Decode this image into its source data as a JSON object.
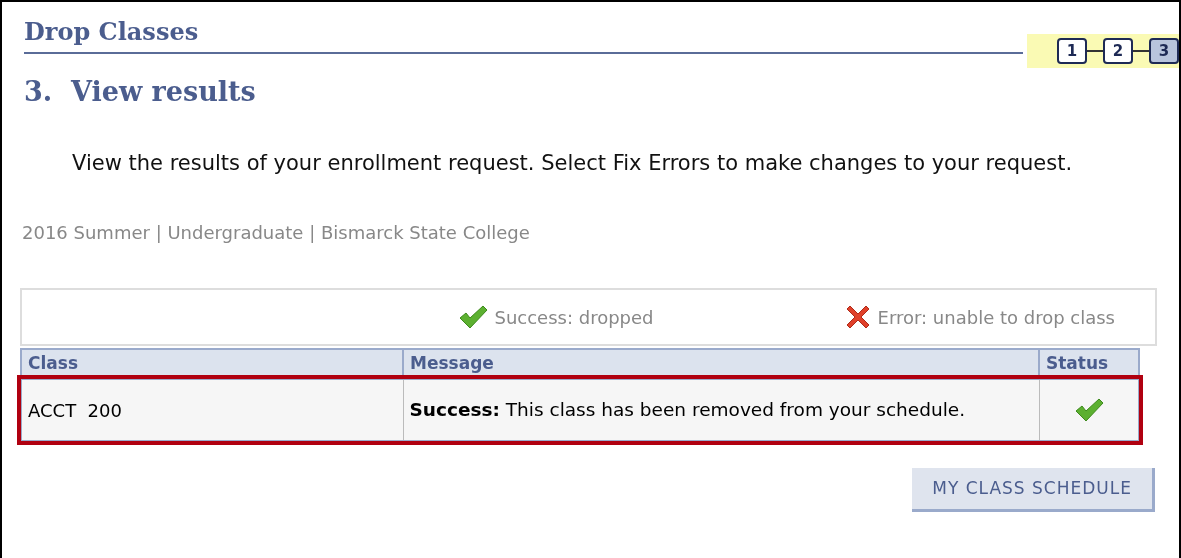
{
  "page_title": "Drop Classes",
  "steps": [
    {
      "label": "1",
      "selected": false
    },
    {
      "label": "2",
      "selected": false
    },
    {
      "label": "3",
      "selected": true
    }
  ],
  "step_heading": "3.  View results",
  "instructions": "View the results of your enrollment request.  Select Fix Errors to make changes to your request.",
  "term_info": "2016 Summer | Undergraduate | Bismarck State College",
  "legend": [
    {
      "kind": "success",
      "label": "Success: dropped"
    },
    {
      "kind": "error",
      "label": "Error: unable to drop class"
    }
  ],
  "table": {
    "columns": [
      "Class",
      "Message",
      "Status"
    ],
    "rows": [
      {
        "class": "ACCT  200",
        "message": "**Success:** This class has been removed from your schedule.",
        "kind": "success",
        "highlighted": true
      }
    ]
  },
  "button": "MY CLASS SCHEDULE"
}
